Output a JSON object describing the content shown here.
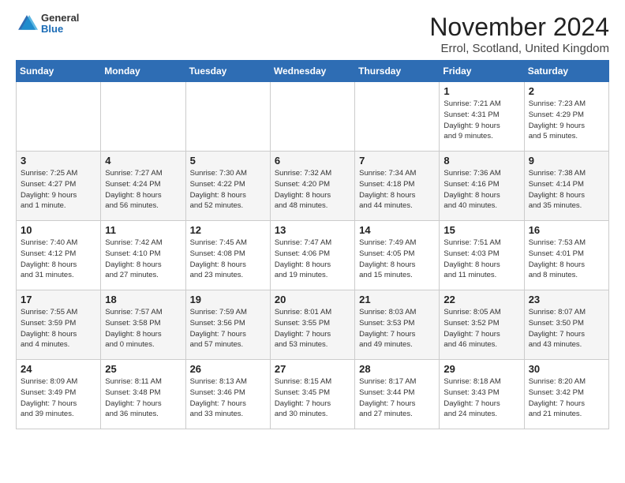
{
  "logo": {
    "general": "General",
    "blue": "Blue"
  },
  "title": "November 2024",
  "location": "Errol, Scotland, United Kingdom",
  "days_of_week": [
    "Sunday",
    "Monday",
    "Tuesday",
    "Wednesday",
    "Thursday",
    "Friday",
    "Saturday"
  ],
  "weeks": [
    [
      {
        "day": "",
        "info": ""
      },
      {
        "day": "",
        "info": ""
      },
      {
        "day": "",
        "info": ""
      },
      {
        "day": "",
        "info": ""
      },
      {
        "day": "",
        "info": ""
      },
      {
        "day": "1",
        "info": "Sunrise: 7:21 AM\nSunset: 4:31 PM\nDaylight: 9 hours\nand 9 minutes."
      },
      {
        "day": "2",
        "info": "Sunrise: 7:23 AM\nSunset: 4:29 PM\nDaylight: 9 hours\nand 5 minutes."
      }
    ],
    [
      {
        "day": "3",
        "info": "Sunrise: 7:25 AM\nSunset: 4:27 PM\nDaylight: 9 hours\nand 1 minute."
      },
      {
        "day": "4",
        "info": "Sunrise: 7:27 AM\nSunset: 4:24 PM\nDaylight: 8 hours\nand 56 minutes."
      },
      {
        "day": "5",
        "info": "Sunrise: 7:30 AM\nSunset: 4:22 PM\nDaylight: 8 hours\nand 52 minutes."
      },
      {
        "day": "6",
        "info": "Sunrise: 7:32 AM\nSunset: 4:20 PM\nDaylight: 8 hours\nand 48 minutes."
      },
      {
        "day": "7",
        "info": "Sunrise: 7:34 AM\nSunset: 4:18 PM\nDaylight: 8 hours\nand 44 minutes."
      },
      {
        "day": "8",
        "info": "Sunrise: 7:36 AM\nSunset: 4:16 PM\nDaylight: 8 hours\nand 40 minutes."
      },
      {
        "day": "9",
        "info": "Sunrise: 7:38 AM\nSunset: 4:14 PM\nDaylight: 8 hours\nand 35 minutes."
      }
    ],
    [
      {
        "day": "10",
        "info": "Sunrise: 7:40 AM\nSunset: 4:12 PM\nDaylight: 8 hours\nand 31 minutes."
      },
      {
        "day": "11",
        "info": "Sunrise: 7:42 AM\nSunset: 4:10 PM\nDaylight: 8 hours\nand 27 minutes."
      },
      {
        "day": "12",
        "info": "Sunrise: 7:45 AM\nSunset: 4:08 PM\nDaylight: 8 hours\nand 23 minutes."
      },
      {
        "day": "13",
        "info": "Sunrise: 7:47 AM\nSunset: 4:06 PM\nDaylight: 8 hours\nand 19 minutes."
      },
      {
        "day": "14",
        "info": "Sunrise: 7:49 AM\nSunset: 4:05 PM\nDaylight: 8 hours\nand 15 minutes."
      },
      {
        "day": "15",
        "info": "Sunrise: 7:51 AM\nSunset: 4:03 PM\nDaylight: 8 hours\nand 11 minutes."
      },
      {
        "day": "16",
        "info": "Sunrise: 7:53 AM\nSunset: 4:01 PM\nDaylight: 8 hours\nand 8 minutes."
      }
    ],
    [
      {
        "day": "17",
        "info": "Sunrise: 7:55 AM\nSunset: 3:59 PM\nDaylight: 8 hours\nand 4 minutes."
      },
      {
        "day": "18",
        "info": "Sunrise: 7:57 AM\nSunset: 3:58 PM\nDaylight: 8 hours\nand 0 minutes."
      },
      {
        "day": "19",
        "info": "Sunrise: 7:59 AM\nSunset: 3:56 PM\nDaylight: 7 hours\nand 57 minutes."
      },
      {
        "day": "20",
        "info": "Sunrise: 8:01 AM\nSunset: 3:55 PM\nDaylight: 7 hours\nand 53 minutes."
      },
      {
        "day": "21",
        "info": "Sunrise: 8:03 AM\nSunset: 3:53 PM\nDaylight: 7 hours\nand 49 minutes."
      },
      {
        "day": "22",
        "info": "Sunrise: 8:05 AM\nSunset: 3:52 PM\nDaylight: 7 hours\nand 46 minutes."
      },
      {
        "day": "23",
        "info": "Sunrise: 8:07 AM\nSunset: 3:50 PM\nDaylight: 7 hours\nand 43 minutes."
      }
    ],
    [
      {
        "day": "24",
        "info": "Sunrise: 8:09 AM\nSunset: 3:49 PM\nDaylight: 7 hours\nand 39 minutes."
      },
      {
        "day": "25",
        "info": "Sunrise: 8:11 AM\nSunset: 3:48 PM\nDaylight: 7 hours\nand 36 minutes."
      },
      {
        "day": "26",
        "info": "Sunrise: 8:13 AM\nSunset: 3:46 PM\nDaylight: 7 hours\nand 33 minutes."
      },
      {
        "day": "27",
        "info": "Sunrise: 8:15 AM\nSunset: 3:45 PM\nDaylight: 7 hours\nand 30 minutes."
      },
      {
        "day": "28",
        "info": "Sunrise: 8:17 AM\nSunset: 3:44 PM\nDaylight: 7 hours\nand 27 minutes."
      },
      {
        "day": "29",
        "info": "Sunrise: 8:18 AM\nSunset: 3:43 PM\nDaylight: 7 hours\nand 24 minutes."
      },
      {
        "day": "30",
        "info": "Sunrise: 8:20 AM\nSunset: 3:42 PM\nDaylight: 7 hours\nand 21 minutes."
      }
    ]
  ]
}
